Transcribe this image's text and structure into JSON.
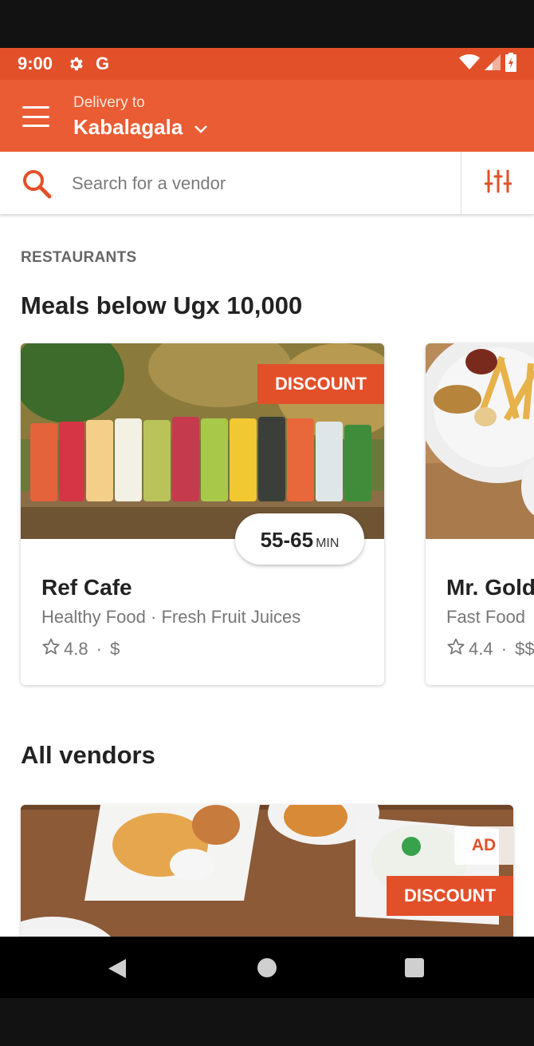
{
  "status_bar": {
    "time": "9:00",
    "carrier_icon_label": "G"
  },
  "header": {
    "delivery_label": "Delivery to",
    "location": "Kabalagala"
  },
  "search": {
    "placeholder": "Search for a vendor"
  },
  "restaurants": {
    "section_label": "RESTAURANTS",
    "title": "Meals below Ugx 10,000",
    "cards": [
      {
        "badge": "DISCOUNT",
        "delivery_time": "55-65",
        "delivery_unit": "MIN",
        "name": "Ref Cafe",
        "tag1": "Healthy Food",
        "tag2": "Fresh Fruit Juices",
        "rating": "4.8",
        "price": "$"
      },
      {
        "name": "Mr. Gold",
        "tag1": "Fast Food",
        "rating": "4.4",
        "price": "$$"
      }
    ]
  },
  "all_vendors": {
    "title": "All vendors",
    "first_card": {
      "ad_label": "AD",
      "badge": "DISCOUNT"
    }
  },
  "colors": {
    "accent": "#EA5C33",
    "status_bar": "#E2502A"
  },
  "icons": [
    "settings-icon",
    "google-icon",
    "wifi-icon",
    "signal-icon",
    "battery-icon",
    "menu-icon",
    "chevron-down-icon",
    "search-icon",
    "filter-icon",
    "star-icon",
    "back-icon",
    "home-icon",
    "recents-icon"
  ]
}
